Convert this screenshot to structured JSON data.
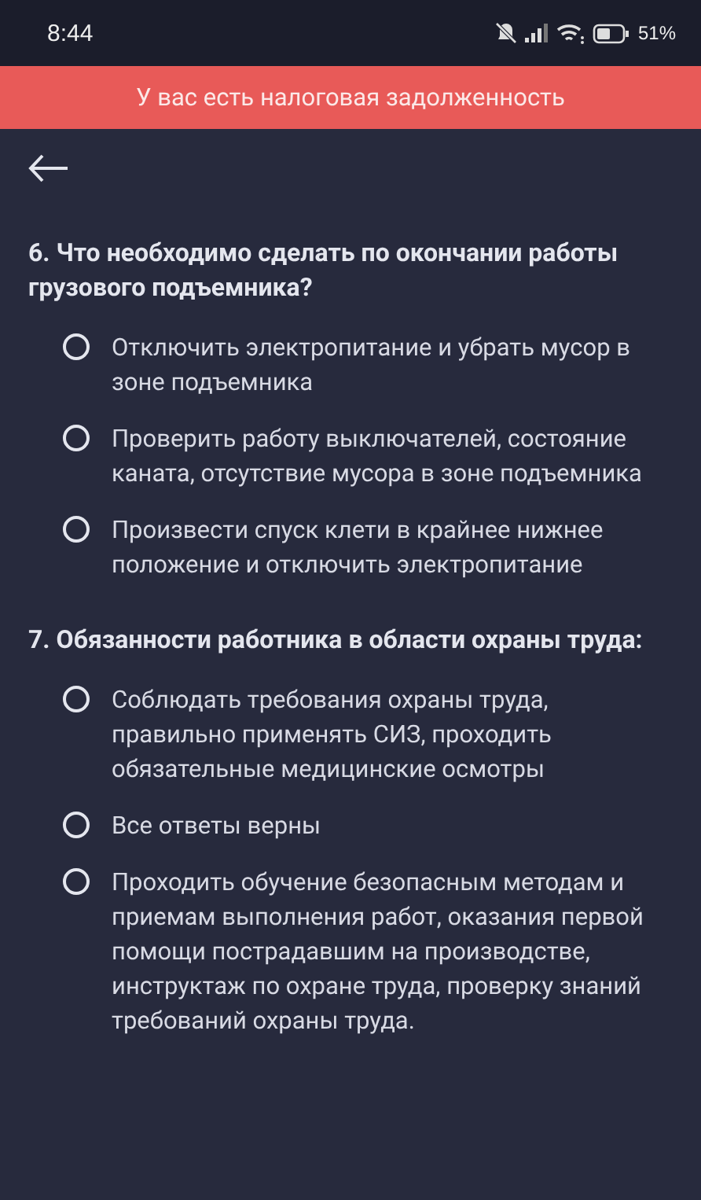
{
  "status_bar": {
    "time": "8:44",
    "battery": "51%"
  },
  "banner": {
    "text": "У вас есть налоговая задолженность"
  },
  "questions": [
    {
      "title": "6. Что необходимо сделать по окончании работы грузового подъемника?",
      "options": [
        {
          "text": "Отключить электропитание и убрать мусор в зоне подъемника",
          "selected": false
        },
        {
          "text": "Проверить работу выключателей, состояние каната, отсутствие мусора в зоне подъемника",
          "selected": false
        },
        {
          "text": "Произвести спуск клети в крайнее нижнее положение и отключить электропитание",
          "selected": false
        }
      ]
    },
    {
      "title": "7. Обязанности работника в области охраны труда:",
      "options": [
        {
          "text": "Соблюдать требования охраны труда, правильно применять СИЗ, проходить обязательные медицинские осмотры",
          "selected": false
        },
        {
          "text": "Все ответы верны",
          "selected": false
        },
        {
          "text": "Проходить обучение безопасным методам и приемам выполнения работ, оказания первой помощи пострадавшим на производстве, инструктаж по охране труда, проверку знаний требований охраны труда.",
          "selected": false
        }
      ]
    }
  ]
}
